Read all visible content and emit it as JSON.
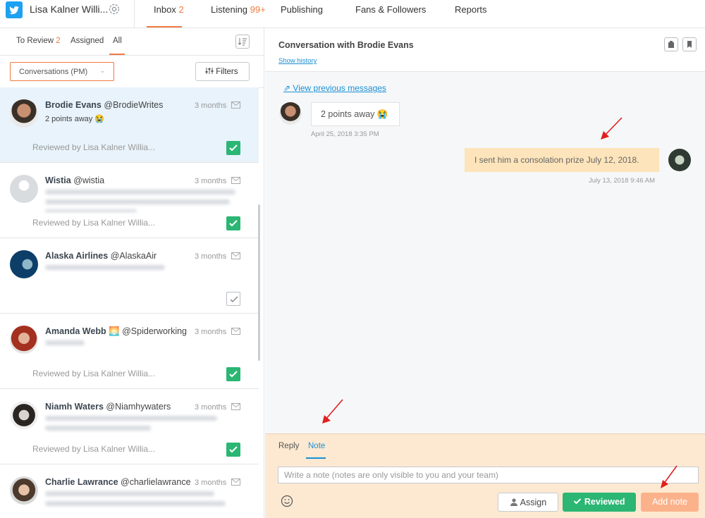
{
  "header": {
    "account": "Lisa Kalner Willi...",
    "tabs": [
      {
        "label": "Inbox",
        "count": "2"
      },
      {
        "label": "Listening",
        "count": "99+"
      },
      {
        "label": "Publishing",
        "count": ""
      },
      {
        "label": "Fans & Followers",
        "count": ""
      },
      {
        "label": "Reports",
        "count": ""
      }
    ]
  },
  "left": {
    "filter_tabs": [
      {
        "label": "To Review",
        "count": "2"
      },
      {
        "label": "Assigned",
        "count": ""
      },
      {
        "label": "All",
        "count": ""
      }
    ],
    "dropdown": "Conversations (PM)",
    "filters_label": "Filters",
    "items": [
      {
        "name": "Brodie Evans",
        "handle": "@BrodieWrites",
        "time": "3 months",
        "preview": "2 points away 😭",
        "reviewed": "Reviewed by Lisa Kalner Willia...",
        "checked": true
      },
      {
        "name": "Wistia",
        "handle": "@wistia",
        "time": "3 months",
        "preview": "",
        "reviewed": "Reviewed by Lisa Kalner Willia...",
        "checked": true
      },
      {
        "name": "Alaska Airlines",
        "handle": "@AlaskaAir",
        "time": "3 months",
        "preview": "",
        "reviewed": "",
        "checked": false
      },
      {
        "name": "Amanda Webb 🌅",
        "handle": "@Spiderworking",
        "time": "3 months",
        "preview": "",
        "reviewed": "Reviewed by Lisa Kalner Willia...",
        "checked": true
      },
      {
        "name": "Niamh Waters",
        "handle": "@Niamhywaters",
        "time": "3 months",
        "preview": "",
        "reviewed": "Reviewed by Lisa Kalner Willia...",
        "checked": true
      },
      {
        "name": "Charlie Lawrance",
        "handle": "@charlielawrance",
        "time": "3 months",
        "preview": "",
        "reviewed": "",
        "checked": false
      }
    ]
  },
  "conversation": {
    "title": "Conversation with Brodie Evans",
    "show_history": "Show history",
    "view_previous": "View previous messages",
    "msg1": {
      "text": "2 points away 😭",
      "date": "April 25, 2018 3:35 PM"
    },
    "msg2": {
      "text": "I sent him a consolation prize July 12, 2018.",
      "date": "July 13, 2018 9:46 AM"
    }
  },
  "composer": {
    "tabs": [
      "Reply",
      "Note"
    ],
    "placeholder": "Write a note (notes are only visible to you and your team)",
    "assign": "Assign",
    "reviewed": "Reviewed",
    "add_note": "Add note"
  },
  "colors": {
    "accent": "#f07b3f",
    "link": "#1a8fd6",
    "success": "#2bb673",
    "note_bg": "#fde9d1",
    "bubble_out": "#fde4bb"
  }
}
